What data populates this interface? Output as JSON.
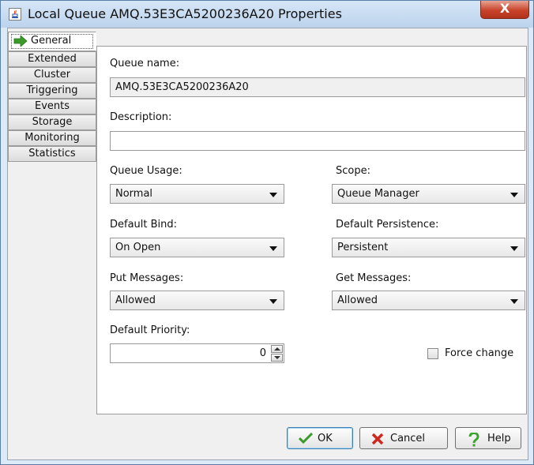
{
  "window": {
    "title": "Local Queue AMQ.53E3CA5200236A20 Properties",
    "close_label": "X"
  },
  "tabs": [
    {
      "label": "General",
      "active": true,
      "icon": "green-arrow-icon"
    },
    {
      "label": "Extended"
    },
    {
      "label": "Cluster"
    },
    {
      "label": "Triggering"
    },
    {
      "label": "Events"
    },
    {
      "label": "Storage"
    },
    {
      "label": "Monitoring"
    },
    {
      "label": "Statistics"
    }
  ],
  "general": {
    "queue_name_label": "Queue name:",
    "queue_name_value": "AMQ.53E3CA5200236A20",
    "description_label": "Description:",
    "description_value": "",
    "queue_usage_label": "Queue Usage:",
    "queue_usage_value": "Normal",
    "scope_label": "Scope:",
    "scope_value": "Queue Manager",
    "default_bind_label": "Default Bind:",
    "default_bind_value": "On Open",
    "default_persistence_label": "Default Persistence:",
    "default_persistence_value": "Persistent",
    "put_messages_label": "Put Messages:",
    "put_messages_value": "Allowed",
    "get_messages_label": "Get Messages:",
    "get_messages_value": "Allowed",
    "default_priority_label": "Default Priority:",
    "default_priority_value": "0",
    "force_change_label": "Force change",
    "force_change_checked": false
  },
  "buttons": {
    "ok_label": "OK",
    "cancel_label": "Cancel",
    "help_label": "Help"
  },
  "colors": {
    "title_bar": "#bcd3ec",
    "close_button": "#c7432a",
    "ok_check": "#3a9a2a",
    "cancel_x": "#d0271d",
    "help_icon": "#3aa42d"
  }
}
